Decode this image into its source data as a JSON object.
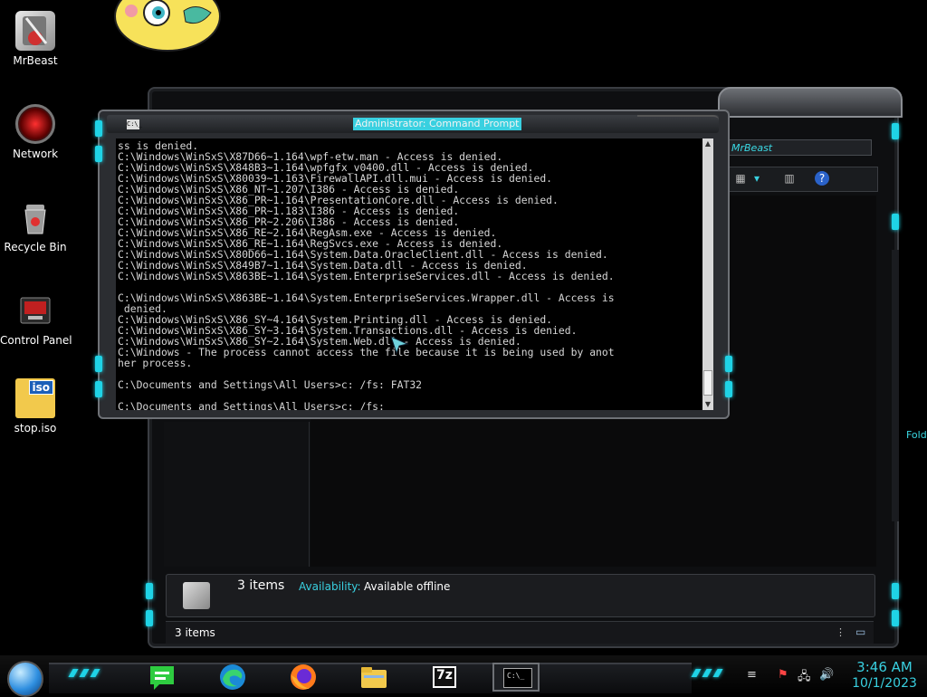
{
  "desktop": {
    "icons": [
      {
        "label": "MrBeast"
      },
      {
        "label": "Network"
      },
      {
        "label": "Recycle Bin"
      },
      {
        "label": "Control Panel"
      },
      {
        "label": "stop.iso",
        "badge": "iso"
      }
    ]
  },
  "explorer": {
    "address": "MrBeast",
    "side_label": "Fold",
    "details": {
      "count": "3 items",
      "availability_key": "Availability:",
      "availability_value": "Available offline"
    },
    "status": "3 items",
    "accent": "#39d0e0"
  },
  "cmd": {
    "icon_text": "C:\\_",
    "title": "Administrator: Command Prompt",
    "lines": [
      "ss is denied.",
      "C:\\Windows\\WinSxS\\X87D66~1.164\\wpf-etw.man - Access is denied.",
      "C:\\Windows\\WinSxS\\X848B3~1.164\\wpfgfx_v0400.dll - Access is denied.",
      "C:\\Windows\\WinSxS\\X80039~1.163\\FirewallAPI.dll.mui - Access is denied.",
      "C:\\Windows\\WinSxS\\X86_NT~1.207\\I386 - Access is denied.",
      "C:\\Windows\\WinSxS\\X86_PR~1.164\\PresentationCore.dll - Access is denied.",
      "C:\\Windows\\WinSxS\\X86_PR~1.183\\I386 - Access is denied.",
      "C:\\Windows\\WinSxS\\X86_PR~2.206\\I386 - Access is denied.",
      "C:\\Windows\\WinSxS\\X86_RE~2.164\\RegAsm.exe - Access is denied.",
      "C:\\Windows\\WinSxS\\X86_RE~1.164\\RegSvcs.exe - Access is denied.",
      "C:\\Windows\\WinSxS\\X80D66~1.164\\System.Data.OracleClient.dll - Access is denied.",
      "C:\\Windows\\WinSxS\\X849B7~1.164\\System.Data.dll - Access is denied.",
      "C:\\Windows\\WinSxS\\X863BE~1.164\\System.EnterpriseServices.dll - Access is denied.",
      "",
      "C:\\Windows\\WinSxS\\X863BE~1.164\\System.EnterpriseServices.Wrapper.dll - Access is",
      " denied.",
      "C:\\Windows\\WinSxS\\X86_SY~4.164\\System.Printing.dll - Access is denied.",
      "C:\\Windows\\WinSxS\\X86_SY~3.164\\System.Transactions.dll - Access is denied.",
      "C:\\Windows\\WinSxS\\X86_SY~2.164\\System.Web.dll - Access is denied.",
      "C:\\Windows - The process cannot access the file because it is being used by anot",
      "her process.",
      "",
      "C:\\Documents and Settings\\All Users>c: /fs: FAT32",
      "",
      "C:\\Documents and Settings\\All Users>c: /fs:"
    ]
  },
  "taskbar": {
    "apps": [
      {
        "name": "feedback-hub"
      },
      {
        "name": "edge"
      },
      {
        "name": "firefox"
      },
      {
        "name": "file-explorer"
      },
      {
        "name": "7zip",
        "text": "7z"
      },
      {
        "name": "command-prompt",
        "text": "C:\\_"
      }
    ],
    "clock_time": "3:46 AM",
    "clock_date": "10/1/2023"
  }
}
